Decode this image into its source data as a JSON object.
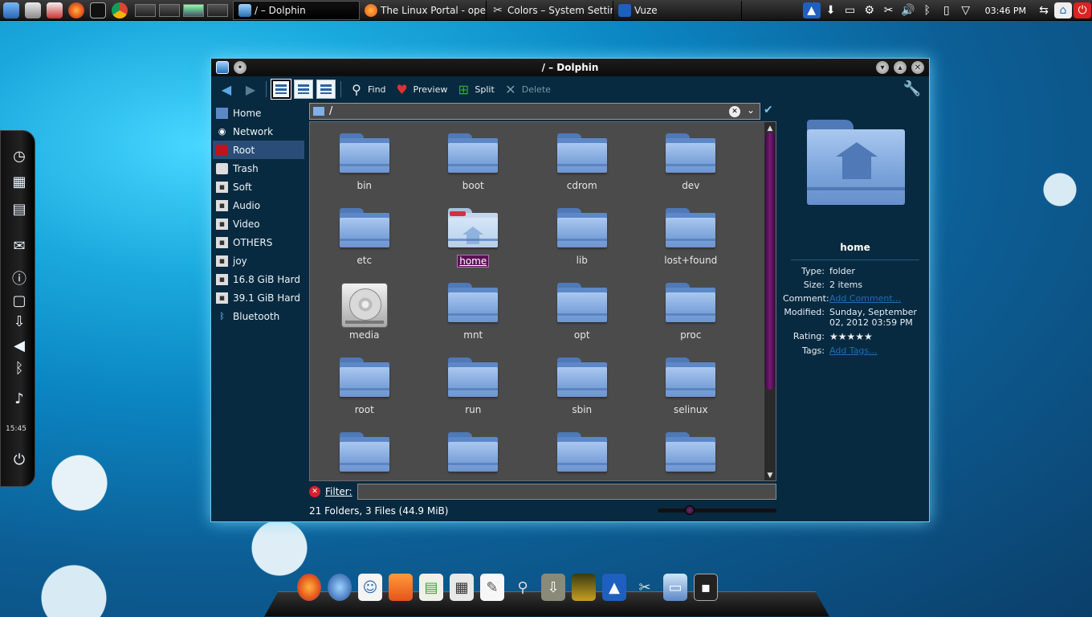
{
  "taskbar": {
    "tasks": [
      {
        "label": "/ – Dolphin",
        "active": true
      },
      {
        "label": "The Linux Portal - oper"
      },
      {
        "label": "Colors – System Setting"
      },
      {
        "label": "Vuze"
      }
    ],
    "clock": "03:46 PM"
  },
  "left_dock": {
    "time": "15:45"
  },
  "window": {
    "title": "/ – Dolphin",
    "toolbar": {
      "find": "Find",
      "preview": "Preview",
      "split": "Split",
      "delete": "Delete"
    },
    "places": [
      {
        "label": "Home"
      },
      {
        "label": "Network"
      },
      {
        "label": "Root",
        "selected": true
      },
      {
        "label": "Trash"
      },
      {
        "label": "Soft"
      },
      {
        "label": "Audio"
      },
      {
        "label": "Video"
      },
      {
        "label": "OTHERS"
      },
      {
        "label": "joy"
      },
      {
        "label": "16.8 GiB Hard ..."
      },
      {
        "label": "39.1 GiB Hard ..."
      },
      {
        "label": "Bluetooth"
      }
    ],
    "location": "/",
    "files": [
      {
        "name": "bin"
      },
      {
        "name": "boot"
      },
      {
        "name": "cdrom"
      },
      {
        "name": "dev"
      },
      {
        "name": "etc"
      },
      {
        "name": "home",
        "selected": true
      },
      {
        "name": "lib"
      },
      {
        "name": "lost+found"
      },
      {
        "name": "media"
      },
      {
        "name": "mnt"
      },
      {
        "name": "opt"
      },
      {
        "name": "proc"
      },
      {
        "name": "root"
      },
      {
        "name": "run"
      },
      {
        "name": "sbin"
      },
      {
        "name": "selinux"
      },
      {
        "name": ""
      },
      {
        "name": ""
      },
      {
        "name": ""
      },
      {
        "name": ""
      }
    ],
    "filter_label": "Filter:",
    "status": "21 Folders, 3 Files (44.9 MiB)",
    "info": {
      "name": "home",
      "type_label": "Type:",
      "type": "folder",
      "size_label": "Size:",
      "size": "2 items",
      "comment_label": "Comment:",
      "comment": "Add Comment...",
      "modified_label": "Modified:",
      "modified": "Sunday, September 02, 2012 03:59 PM",
      "rating_label": "Rating:",
      "rating": "★★★★★",
      "tags_label": "Tags:",
      "tags": "Add Tags..."
    }
  },
  "colors": {
    "accent": "#6ac8ee",
    "selection": "#5e1057"
  }
}
